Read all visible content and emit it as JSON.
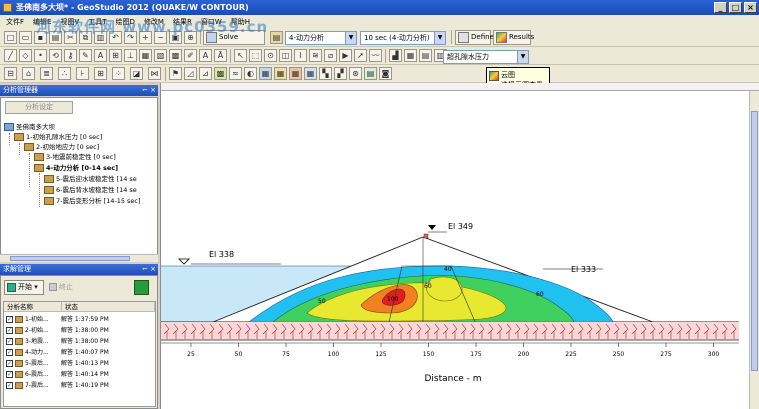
{
  "window": {
    "title": "圣佛南多大坝* - GeoStudio 2012 (QUAKE/W CONTOUR)",
    "buttons": [
      "_",
      "□",
      "×"
    ]
  },
  "menu": [
    "文件F",
    "编辑E",
    "视图V",
    "工具T",
    "绘图D",
    "修改M",
    "结果R",
    "窗口W",
    "帮助H"
  ],
  "watermark": "河东软件网 www.pc0359.cn",
  "toolbar1": {
    "solve_manager": "Solve Manager",
    "analysis_select": "4-动力分析",
    "time_select": "10 sec (4-动力分析)",
    "define": "Define",
    "results": "Results"
  },
  "toolbar2": {
    "contour_select": "超孔隙水压力"
  },
  "tooltip": {
    "title": "云图",
    "text": "选择云图查看"
  },
  "analysis_panel": {
    "title": "分析管理器",
    "settings_button": "分析设定",
    "tree": [
      {
        "label": "圣佛南多大坝",
        "level": 0,
        "bold": false
      },
      {
        "label": "1-初始孔隙水压力 [0 sec]",
        "level": 1,
        "bold": false
      },
      {
        "label": "2-初始地应力 [0 sec]",
        "level": 2,
        "bold": false
      },
      {
        "label": "3-地震前稳定性 [0 sec]",
        "level": 3,
        "bold": false
      },
      {
        "label": "4-动力分析 [0-14 sec]",
        "level": 3,
        "bold": true
      },
      {
        "label": "5-震后迎水坡稳定性 [14 se",
        "level": 4,
        "bold": false
      },
      {
        "label": "6-震后背水坡稳定性 [14 se",
        "level": 4,
        "bold": false
      },
      {
        "label": "7-震后变形分析 [14-15 sec]",
        "level": 4,
        "bold": false
      }
    ]
  },
  "solve_panel": {
    "title": "求解管理",
    "start_button": "开始",
    "stop_button": "终止",
    "columns": [
      "分析名称",
      "状态"
    ],
    "rows": [
      {
        "name": "1-初始...",
        "status": "解答 1:37:59 PM"
      },
      {
        "name": "2-初始...",
        "status": "解答 1:38:00 PM"
      },
      {
        "name": "3-地震...",
        "status": "解答 1:38:00 PM"
      },
      {
        "name": "4-动力...",
        "status": "解答 1:40:07 PM"
      },
      {
        "name": "5-震后...",
        "status": "解答 1:40:13 PM"
      },
      {
        "name": "6-震后...",
        "status": "解答 1:40:14 PM"
      },
      {
        "name": "7-震后...",
        "status": "解答 1:40:19 PM"
      }
    ]
  },
  "drawing": {
    "labels": {
      "el_crest": "El 349",
      "el_left": "El 338",
      "el_right": "El 333"
    },
    "contours": [
      "40",
      "60",
      "60",
      "100",
      "50"
    ],
    "axis": {
      "ticks": [
        "25",
        "50",
        "75",
        "100",
        "125",
        "150",
        "175",
        "200",
        "225",
        "250",
        "275",
        "300"
      ],
      "xlabel": "Distance - m"
    },
    "colors": {
      "water": "#c8e8f8",
      "contour_low": "#20c0f0",
      "contour_mid1": "#40d060",
      "contour_mid2": "#e8e830",
      "contour_high": "#f08020",
      "contour_peak": "#e02020",
      "foundation": "#f8d8d8",
      "hatch": "#c02020"
    }
  }
}
